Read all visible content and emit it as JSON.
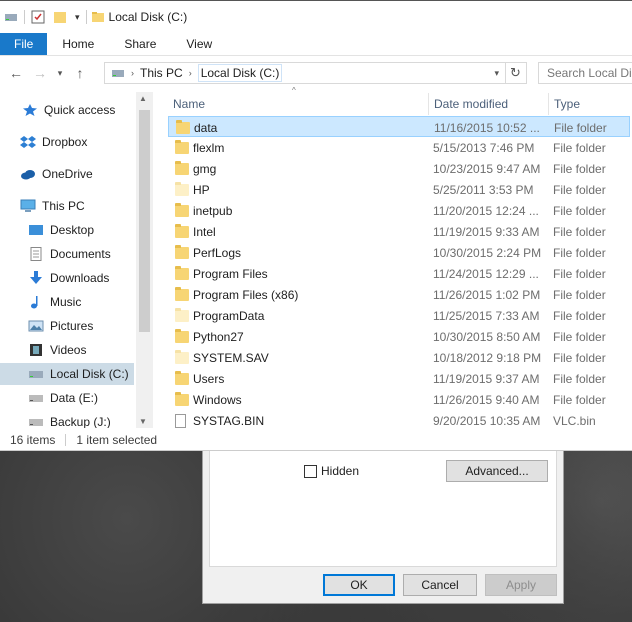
{
  "window": {
    "title": "Local Disk (C:)"
  },
  "ribbon": {
    "tabs": [
      {
        "label": "File"
      },
      {
        "label": "Home"
      },
      {
        "label": "Share"
      },
      {
        "label": "View"
      }
    ]
  },
  "address": {
    "crumbs": [
      "This PC",
      "Local Disk (C:)"
    ],
    "search_placeholder": "Search Local Disk (C:)"
  },
  "sidebar": {
    "items": [
      {
        "label": "Quick access",
        "icon": "star-icon"
      },
      {
        "label": "Dropbox",
        "icon": "dropbox-icon"
      },
      {
        "label": "OneDrive",
        "icon": "cloud-icon"
      },
      {
        "label": "This PC",
        "icon": "computer-icon"
      },
      {
        "label": "Desktop",
        "icon": "desktop-icon"
      },
      {
        "label": "Documents",
        "icon": "documents-icon"
      },
      {
        "label": "Downloads",
        "icon": "download-arrow-icon"
      },
      {
        "label": "Music",
        "icon": "music-note-icon"
      },
      {
        "label": "Pictures",
        "icon": "pictures-icon"
      },
      {
        "label": "Videos",
        "icon": "film-icon"
      },
      {
        "label": "Local Disk (C:)",
        "icon": "drive-icon",
        "selected": true
      },
      {
        "label": "Data (E:)",
        "icon": "drive-icon"
      },
      {
        "label": "Backup (J:)",
        "icon": "drive-icon"
      }
    ]
  },
  "columns": {
    "name": "Name",
    "date": "Date modified",
    "type": "Type"
  },
  "files": [
    {
      "name": "data",
      "date": "11/16/2015 10:52 ...",
      "type": "File folder",
      "kind": "folder",
      "selected": true
    },
    {
      "name": "flexlm",
      "date": "5/15/2013 7:46 PM",
      "type": "File folder",
      "kind": "folder"
    },
    {
      "name": "gmg",
      "date": "10/23/2015 9:47 AM",
      "type": "File folder",
      "kind": "folder"
    },
    {
      "name": "HP",
      "date": "5/25/2011 3:53 PM",
      "type": "File folder",
      "kind": "folder-pale"
    },
    {
      "name": "inetpub",
      "date": "11/20/2015 12:24 ...",
      "type": "File folder",
      "kind": "folder"
    },
    {
      "name": "Intel",
      "date": "11/19/2015 9:33 AM",
      "type": "File folder",
      "kind": "folder"
    },
    {
      "name": "PerfLogs",
      "date": "10/30/2015 2:24 PM",
      "type": "File folder",
      "kind": "folder"
    },
    {
      "name": "Program Files",
      "date": "11/24/2015 12:29 ...",
      "type": "File folder",
      "kind": "folder"
    },
    {
      "name": "Program Files (x86)",
      "date": "11/26/2015 1:02 PM",
      "type": "File folder",
      "kind": "folder"
    },
    {
      "name": "ProgramData",
      "date": "11/25/2015 7:33 AM",
      "type": "File folder",
      "kind": "folder-pale"
    },
    {
      "name": "Python27",
      "date": "10/30/2015 8:50 AM",
      "type": "File folder",
      "kind": "folder"
    },
    {
      "name": "SYSTEM.SAV",
      "date": "10/18/2012 9:18 PM",
      "type": "File folder",
      "kind": "folder-pale"
    },
    {
      "name": "Users",
      "date": "11/19/2015 9:37 AM",
      "type": "File folder",
      "kind": "folder"
    },
    {
      "name": "Windows",
      "date": "11/26/2015 9:40 AM",
      "type": "File folder",
      "kind": "folder"
    },
    {
      "name": "SYSTAG.BIN",
      "date": "9/20/2015 10:35 AM",
      "type": "VLC.bin",
      "kind": "file"
    }
  ],
  "status": {
    "count": "16 items",
    "selection": "1 item selected"
  },
  "dialog": {
    "hidden_label": "Hidden",
    "advanced_label": "Advanced...",
    "ok_label": "OK",
    "cancel_label": "Cancel",
    "apply_label": "Apply"
  },
  "colors": {
    "accent": "#1979ca",
    "selection": "#cce8ff"
  }
}
